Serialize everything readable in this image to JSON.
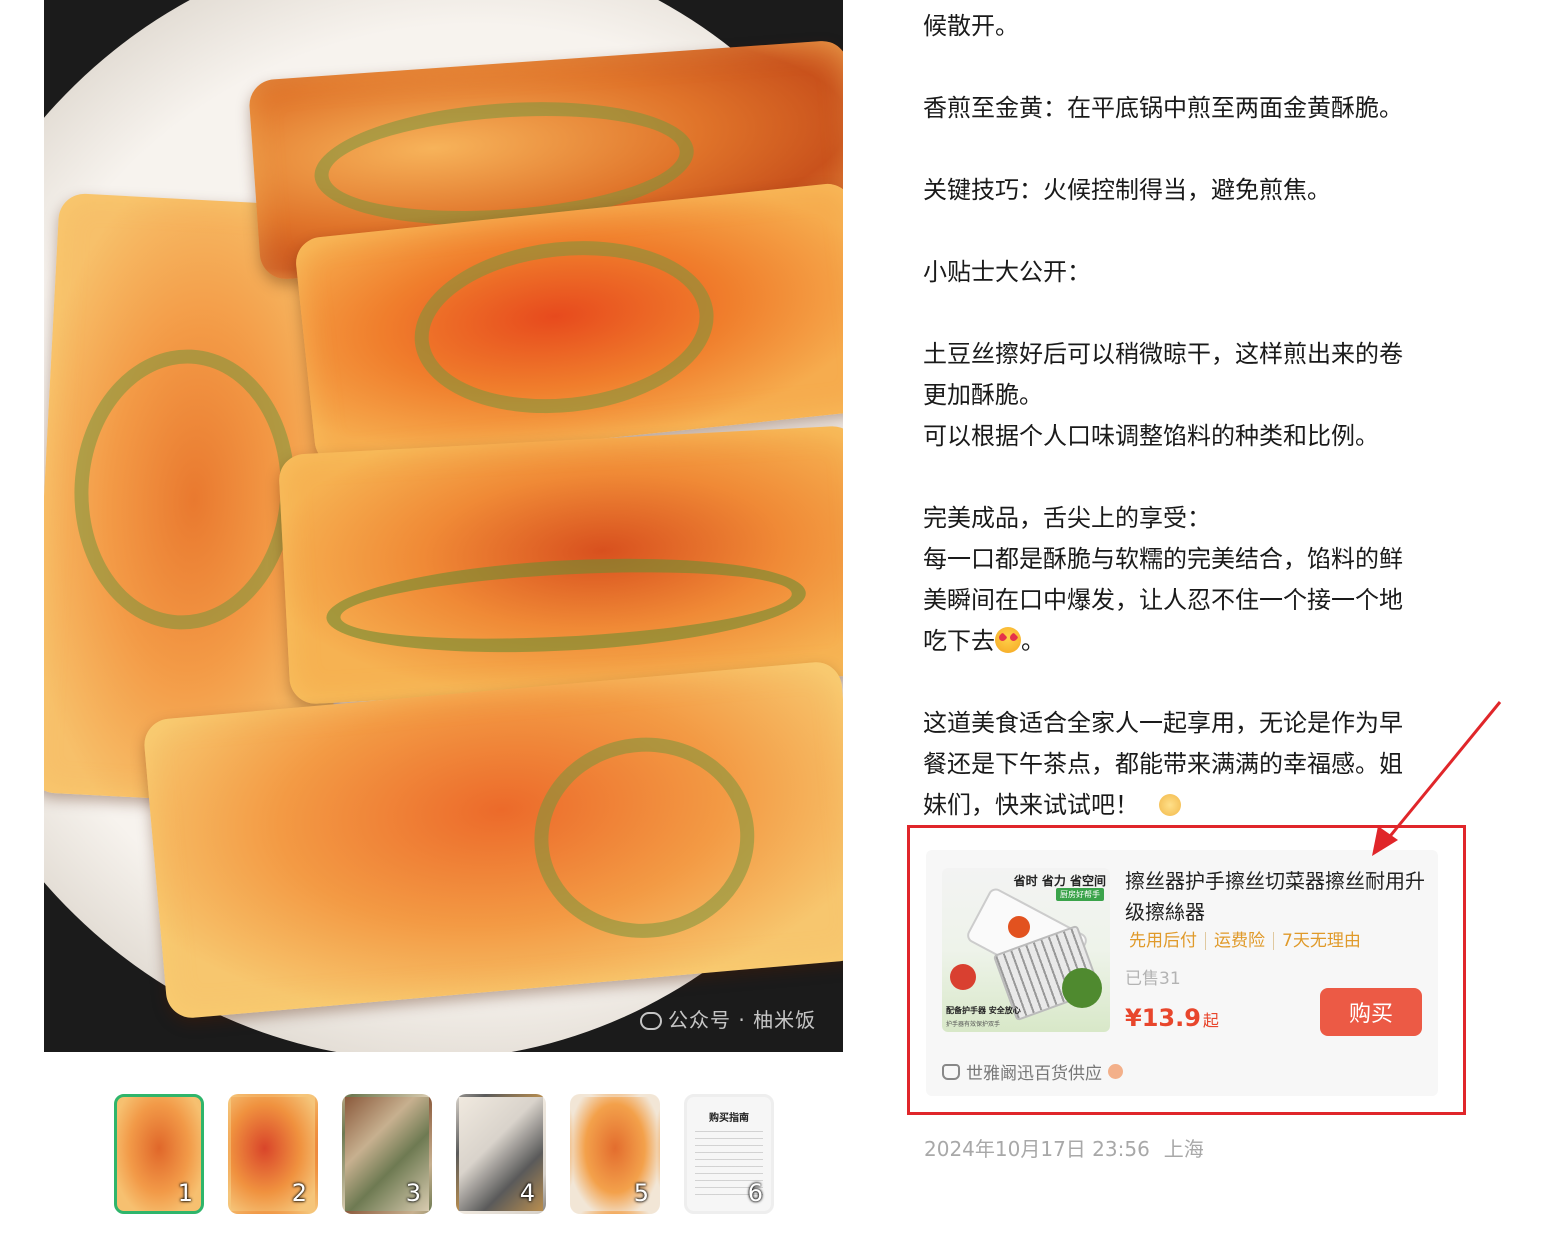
{
  "gallery": {
    "watermark": "公众号 · 柚米饭",
    "thumbnails": [
      {
        "num": "1",
        "active": true
      },
      {
        "num": "2",
        "active": false
      },
      {
        "num": "3",
        "active": false
      },
      {
        "num": "4",
        "active": false
      },
      {
        "num": "5",
        "active": false
      },
      {
        "num": "6",
        "active": false,
        "title": "购买指南"
      }
    ]
  },
  "article": {
    "lines": [
      "候散开。",
      "",
      "香煎至金黄：在平底锅中煎至两面金黄酥脆。",
      "",
      "关键技巧：火候控制得当，避免煎焦。",
      "",
      "小贴士大公开：",
      "",
      "土豆丝擦好后可以稍微晾干，这样煎出来的卷",
      "更加酥脆。",
      "可以根据个人口味调整馅料的种类和比例。",
      "",
      "完美成品，舌尖上的享受：",
      "每一口都是酥脆与软糯的完美结合，馅料的鲜",
      "美瞬间在口中爆发，让人忍不住一个接一个地",
      "吃下去",
      "",
      "这道美食适合全家人一起享用，无论是作为早",
      "餐还是下午茶点，都能带来满满的幸福感。姐",
      "妹们，快来试试吧！"
    ],
    "line16_suffix": "。"
  },
  "product": {
    "image_slogan": "省时 省力 省空间",
    "image_subslogan": "厨房好帮手",
    "image_badge": "配备护手器 安全放心",
    "image_badge_sub": "护手器有效保护双手",
    "title": "擦丝器护手擦丝切菜器擦丝耐用升级擦絲器",
    "tags": [
      "先用后付",
      "运费险",
      "7天无理由"
    ],
    "sold": "已售31",
    "price": "¥13.9",
    "price_suffix": "起",
    "buy_label": "购买",
    "supplier": "世雅阚迅百货供应"
  },
  "meta": {
    "date": "2024年10月17日 23:56",
    "location": "上海"
  },
  "colors": {
    "accent_red": "#ec5a45",
    "annotation_red": "#e0262a",
    "tag_orange": "#e09a2a",
    "active_thumb_border": "#2fb56b"
  }
}
